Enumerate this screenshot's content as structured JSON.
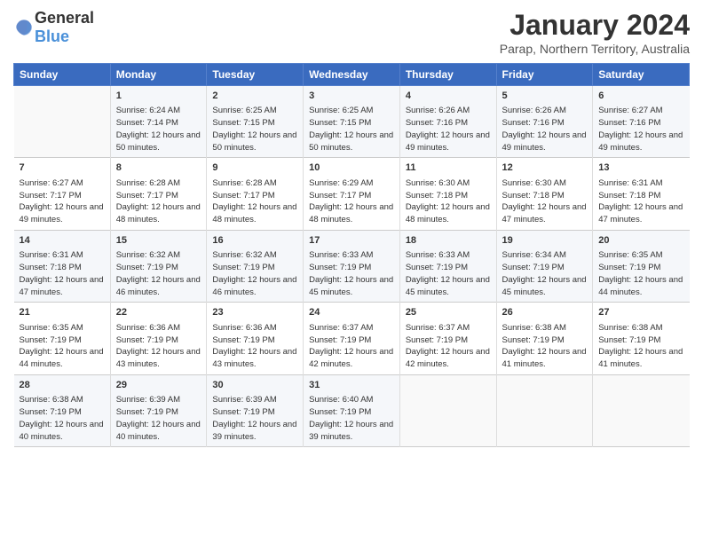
{
  "logo": {
    "general": "General",
    "blue": "Blue"
  },
  "header": {
    "month": "January 2024",
    "location": "Parap, Northern Territory, Australia"
  },
  "days": [
    "Sunday",
    "Monday",
    "Tuesday",
    "Wednesday",
    "Thursday",
    "Friday",
    "Saturday"
  ],
  "weeks": [
    [
      {
        "day": "",
        "sunrise": "",
        "sunset": "",
        "daylight": ""
      },
      {
        "day": "1",
        "sunrise": "Sunrise: 6:24 AM",
        "sunset": "Sunset: 7:14 PM",
        "daylight": "Daylight: 12 hours and 50 minutes."
      },
      {
        "day": "2",
        "sunrise": "Sunrise: 6:25 AM",
        "sunset": "Sunset: 7:15 PM",
        "daylight": "Daylight: 12 hours and 50 minutes."
      },
      {
        "day": "3",
        "sunrise": "Sunrise: 6:25 AM",
        "sunset": "Sunset: 7:15 PM",
        "daylight": "Daylight: 12 hours and 50 minutes."
      },
      {
        "day": "4",
        "sunrise": "Sunrise: 6:26 AM",
        "sunset": "Sunset: 7:16 PM",
        "daylight": "Daylight: 12 hours and 49 minutes."
      },
      {
        "day": "5",
        "sunrise": "Sunrise: 6:26 AM",
        "sunset": "Sunset: 7:16 PM",
        "daylight": "Daylight: 12 hours and 49 minutes."
      },
      {
        "day": "6",
        "sunrise": "Sunrise: 6:27 AM",
        "sunset": "Sunset: 7:16 PM",
        "daylight": "Daylight: 12 hours and 49 minutes."
      }
    ],
    [
      {
        "day": "7",
        "sunrise": "Sunrise: 6:27 AM",
        "sunset": "Sunset: 7:17 PM",
        "daylight": "Daylight: 12 hours and 49 minutes."
      },
      {
        "day": "8",
        "sunrise": "Sunrise: 6:28 AM",
        "sunset": "Sunset: 7:17 PM",
        "daylight": "Daylight: 12 hours and 48 minutes."
      },
      {
        "day": "9",
        "sunrise": "Sunrise: 6:28 AM",
        "sunset": "Sunset: 7:17 PM",
        "daylight": "Daylight: 12 hours and 48 minutes."
      },
      {
        "day": "10",
        "sunrise": "Sunrise: 6:29 AM",
        "sunset": "Sunset: 7:17 PM",
        "daylight": "Daylight: 12 hours and 48 minutes."
      },
      {
        "day": "11",
        "sunrise": "Sunrise: 6:30 AM",
        "sunset": "Sunset: 7:18 PM",
        "daylight": "Daylight: 12 hours and 48 minutes."
      },
      {
        "day": "12",
        "sunrise": "Sunrise: 6:30 AM",
        "sunset": "Sunset: 7:18 PM",
        "daylight": "Daylight: 12 hours and 47 minutes."
      },
      {
        "day": "13",
        "sunrise": "Sunrise: 6:31 AM",
        "sunset": "Sunset: 7:18 PM",
        "daylight": "Daylight: 12 hours and 47 minutes."
      }
    ],
    [
      {
        "day": "14",
        "sunrise": "Sunrise: 6:31 AM",
        "sunset": "Sunset: 7:18 PM",
        "daylight": "Daylight: 12 hours and 47 minutes."
      },
      {
        "day": "15",
        "sunrise": "Sunrise: 6:32 AM",
        "sunset": "Sunset: 7:19 PM",
        "daylight": "Daylight: 12 hours and 46 minutes."
      },
      {
        "day": "16",
        "sunrise": "Sunrise: 6:32 AM",
        "sunset": "Sunset: 7:19 PM",
        "daylight": "Daylight: 12 hours and 46 minutes."
      },
      {
        "day": "17",
        "sunrise": "Sunrise: 6:33 AM",
        "sunset": "Sunset: 7:19 PM",
        "daylight": "Daylight: 12 hours and 45 minutes."
      },
      {
        "day": "18",
        "sunrise": "Sunrise: 6:33 AM",
        "sunset": "Sunset: 7:19 PM",
        "daylight": "Daylight: 12 hours and 45 minutes."
      },
      {
        "day": "19",
        "sunrise": "Sunrise: 6:34 AM",
        "sunset": "Sunset: 7:19 PM",
        "daylight": "Daylight: 12 hours and 45 minutes."
      },
      {
        "day": "20",
        "sunrise": "Sunrise: 6:35 AM",
        "sunset": "Sunset: 7:19 PM",
        "daylight": "Daylight: 12 hours and 44 minutes."
      }
    ],
    [
      {
        "day": "21",
        "sunrise": "Sunrise: 6:35 AM",
        "sunset": "Sunset: 7:19 PM",
        "daylight": "Daylight: 12 hours and 44 minutes."
      },
      {
        "day": "22",
        "sunrise": "Sunrise: 6:36 AM",
        "sunset": "Sunset: 7:19 PM",
        "daylight": "Daylight: 12 hours and 43 minutes."
      },
      {
        "day": "23",
        "sunrise": "Sunrise: 6:36 AM",
        "sunset": "Sunset: 7:19 PM",
        "daylight": "Daylight: 12 hours and 43 minutes."
      },
      {
        "day": "24",
        "sunrise": "Sunrise: 6:37 AM",
        "sunset": "Sunset: 7:19 PM",
        "daylight": "Daylight: 12 hours and 42 minutes."
      },
      {
        "day": "25",
        "sunrise": "Sunrise: 6:37 AM",
        "sunset": "Sunset: 7:19 PM",
        "daylight": "Daylight: 12 hours and 42 minutes."
      },
      {
        "day": "26",
        "sunrise": "Sunrise: 6:38 AM",
        "sunset": "Sunset: 7:19 PM",
        "daylight": "Daylight: 12 hours and 41 minutes."
      },
      {
        "day": "27",
        "sunrise": "Sunrise: 6:38 AM",
        "sunset": "Sunset: 7:19 PM",
        "daylight": "Daylight: 12 hours and 41 minutes."
      }
    ],
    [
      {
        "day": "28",
        "sunrise": "Sunrise: 6:38 AM",
        "sunset": "Sunset: 7:19 PM",
        "daylight": "Daylight: 12 hours and 40 minutes."
      },
      {
        "day": "29",
        "sunrise": "Sunrise: 6:39 AM",
        "sunset": "Sunset: 7:19 PM",
        "daylight": "Daylight: 12 hours and 40 minutes."
      },
      {
        "day": "30",
        "sunrise": "Sunrise: 6:39 AM",
        "sunset": "Sunset: 7:19 PM",
        "daylight": "Daylight: 12 hours and 39 minutes."
      },
      {
        "day": "31",
        "sunrise": "Sunrise: 6:40 AM",
        "sunset": "Sunset: 7:19 PM",
        "daylight": "Daylight: 12 hours and 39 minutes."
      },
      {
        "day": "",
        "sunrise": "",
        "sunset": "",
        "daylight": ""
      },
      {
        "day": "",
        "sunrise": "",
        "sunset": "",
        "daylight": ""
      },
      {
        "day": "",
        "sunrise": "",
        "sunset": "",
        "daylight": ""
      }
    ]
  ]
}
